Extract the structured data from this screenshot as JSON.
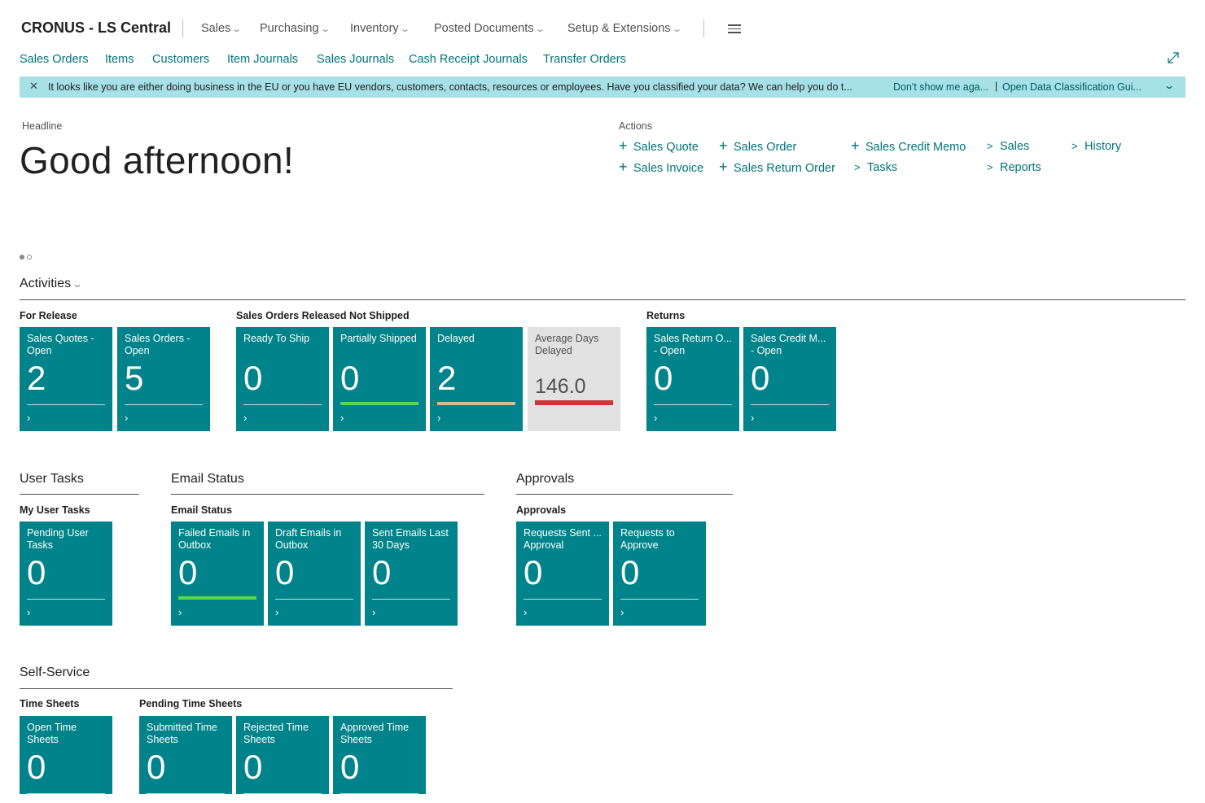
{
  "app": {
    "title": "CRONUS - LS Central"
  },
  "top_menu": [
    "Sales",
    "Purchasing",
    "Inventory",
    "Posted Documents",
    "Setup & Extensions"
  ],
  "quick_links": [
    "Sales Orders",
    "Items",
    "Customers",
    "Item Journals",
    "Sales Journals",
    "Cash Receipt Journals",
    "Transfer Orders"
  ],
  "notification": {
    "message": "It looks like you are either doing business in the EU or you have EU vendors, customers, contacts, resources or employees. Have you classified your data? We can help you do t...",
    "dont_show": "Don't show me aga...",
    "separator": "|",
    "open_guide": "Open Data Classification Gui..."
  },
  "headline": {
    "label": "Headline",
    "greeting": "Good afternoon!"
  },
  "actions": {
    "label": "Actions",
    "items": [
      {
        "prefix": "+",
        "label": "Sales Quote"
      },
      {
        "prefix": "+",
        "label": "Sales Order"
      },
      {
        "prefix": "+",
        "label": "Sales Credit Memo"
      },
      {
        "prefix": ">",
        "label": "Sales"
      },
      {
        "prefix": ">",
        "label": "History"
      },
      {
        "prefix": "+",
        "label": "Sales Invoice"
      },
      {
        "prefix": "+",
        "label": "Sales Return Order"
      },
      {
        "prefix": ">",
        "label": "Tasks"
      },
      {
        "prefix": ">",
        "label": "Reports"
      }
    ]
  },
  "activities": {
    "title": "Activities",
    "groups": [
      {
        "label": "For Release",
        "tiles": [
          {
            "label": "Sales Quotes - Open",
            "value": "2"
          },
          {
            "label": "Sales Orders - Open",
            "value": "5"
          }
        ]
      },
      {
        "label": "Sales Orders Released Not Shipped",
        "tiles": [
          {
            "label": "Ready To Ship",
            "value": "0"
          },
          {
            "label": "Partially Shipped",
            "value": "0",
            "indicator": "#5fd35f"
          },
          {
            "label": "Delayed",
            "value": "2",
            "indicator": "#d9b99b"
          },
          {
            "label": "Average Days Delayed",
            "value": "146.0",
            "indicator": "#d13438"
          }
        ]
      },
      {
        "label": "Returns",
        "tiles": [
          {
            "label": "Sales Return O... - Open",
            "value": "0"
          },
          {
            "label": "Sales Credit M... - Open",
            "value": "0"
          }
        ]
      }
    ]
  },
  "user_tasks": {
    "title": "User Tasks",
    "group": "My User Tasks",
    "tiles": [
      {
        "label": "Pending User Tasks",
        "value": "0"
      }
    ]
  },
  "email_status": {
    "title": "Email Status",
    "group": "Email Status",
    "tiles": [
      {
        "label": "Failed Emails in Outbox",
        "value": "0",
        "indicator": "#5fd35f"
      },
      {
        "label": "Draft Emails in Outbox",
        "value": "0"
      },
      {
        "label": "Sent Emails Last 30 Days",
        "value": "0"
      }
    ]
  },
  "approvals": {
    "title": "Approvals",
    "group": "Approvals",
    "tiles": [
      {
        "label": "Requests Sent ... Approval",
        "value": "0"
      },
      {
        "label": "Requests to Approve",
        "value": "0"
      }
    ]
  },
  "self_service": {
    "title": "Self-Service",
    "groups": [
      {
        "label": "Time Sheets",
        "tiles": [
          {
            "label": "Open Time Sheets",
            "value": "0"
          }
        ]
      },
      {
        "label": "Pending Time Sheets",
        "tiles": [
          {
            "label": "Submitted Time Sheets",
            "value": "0"
          },
          {
            "label": "Rejected Time Sheets",
            "value": "0"
          },
          {
            "label": "Approved Time Sheets",
            "value": "0"
          }
        ]
      }
    ]
  },
  "colors": {
    "accent": "#00747a",
    "tile": "#00838a",
    "notification": "#a6e1e8",
    "tile_gray": "#e1e1e1"
  },
  "icons": [
    "close-icon",
    "chevron-down-icon",
    "hamburger-icon",
    "expand-icon",
    "plus-icon",
    "chevron-right-icon"
  ]
}
